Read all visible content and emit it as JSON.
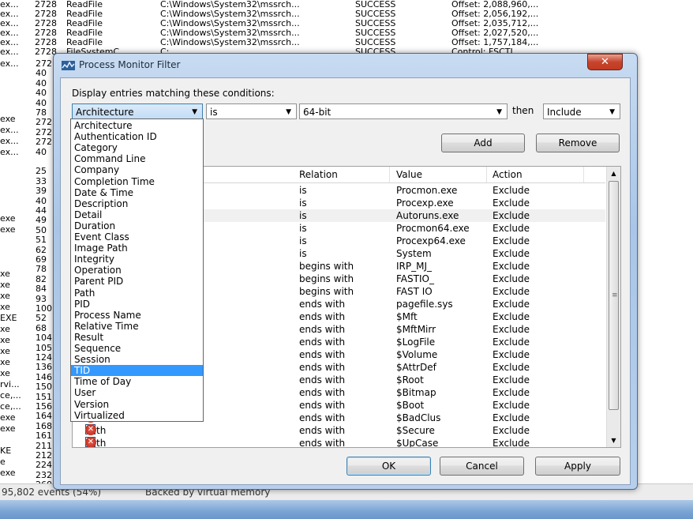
{
  "background": {
    "rows": [
      {
        "name": "ex...",
        "pid": "2728",
        "op": "ReadFile",
        "path": "C:\\Windows\\System32\\mssrch...",
        "result": "SUCCESS",
        "detail": "Offset: 2,088,960,..."
      },
      {
        "name": "ex...",
        "pid": "2728",
        "op": "ReadFile",
        "path": "C:\\Windows\\System32\\mssrch...",
        "result": "SUCCESS",
        "detail": "Offset: 2,056,192,..."
      },
      {
        "name": "ex...",
        "pid": "2728",
        "op": "ReadFile",
        "path": "C:\\Windows\\System32\\mssrch...",
        "result": "SUCCESS",
        "detail": "Offset: 2,035,712,..."
      },
      {
        "name": "ex...",
        "pid": "2728",
        "op": "ReadFile",
        "path": "C:\\Windows\\System32\\mssrch...",
        "result": "SUCCESS",
        "detail": "Offset: 2,027,520,..."
      },
      {
        "name": "ex...",
        "pid": "2728",
        "op": "ReadFile",
        "path": "C:\\Windows\\System32\\mssrch...",
        "result": "SUCCESS",
        "detail": "Offset: 1,757,184,..."
      },
      {
        "name": "ex...",
        "pid": "2728",
        "op": "FileSystemC...",
        "path": "C:",
        "result": "SUCCESS",
        "detail": "Control: FSCTL..."
      }
    ],
    "side_names": [
      "ex...",
      "",
      "",
      "",
      "",
      "exe",
      "ex...",
      "ex...",
      "ex...",
      "",
      "",
      "",
      "",
      "",
      "exe",
      "exe",
      "",
      "",
      "",
      "xe",
      "xe",
      "xe",
      "xe",
      "EXE",
      "xe",
      "xe",
      "xe",
      "xe",
      "xe",
      "rvi...",
      "ce,...",
      "ce,...",
      "exe",
      "exe",
      "",
      "KE",
      "e",
      "exe",
      "",
      "",
      "exe"
    ],
    "side_pids": [
      "272",
      "40",
      "40",
      "40",
      "40",
      "78",
      "272",
      "272",
      "272",
      "40",
      "",
      "25",
      "33",
      "39",
      "40",
      "44",
      "49",
      "50",
      "51",
      "62",
      "69",
      "78",
      "82",
      "84",
      "93",
      "100",
      "52",
      "68",
      "104",
      "105",
      "124",
      "136",
      "146",
      "150",
      "151",
      "156",
      "164",
      "168",
      "161",
      "211",
      "212",
      "224",
      "232",
      "260"
    ],
    "status_events": "95,802 events (54%)",
    "status_memory": "Backed by virtual memory"
  },
  "dialog": {
    "title": "Process Monitor Filter",
    "close_label": "✕",
    "conditions_label": "Display entries matching these conditions:",
    "column_select": "Architecture",
    "relation_select": "is",
    "value_input": "64-bit",
    "then_label": "then",
    "action_select": "Include",
    "add_label": "Add",
    "remove_label": "Remove",
    "ok_label": "OK",
    "cancel_label": "Cancel",
    "apply_label": "Apply"
  },
  "table": {
    "headers": {
      "relation": "Relation",
      "value": "Value",
      "action": "Action"
    },
    "rows": [
      {
        "column": "",
        "relation": "is",
        "value": "Procmon.exe",
        "action": "Exclude"
      },
      {
        "column": "",
        "relation": "is",
        "value": "Procexp.exe",
        "action": "Exclude"
      },
      {
        "column": "",
        "relation": "is",
        "value": "Autoruns.exe",
        "action": "Exclude"
      },
      {
        "column": "",
        "relation": "is",
        "value": "Procmon64.exe",
        "action": "Exclude"
      },
      {
        "column": "",
        "relation": "is",
        "value": "Procexp64.exe",
        "action": "Exclude"
      },
      {
        "column": "",
        "relation": "is",
        "value": "System",
        "action": "Exclude"
      },
      {
        "column": "",
        "relation": "begins with",
        "value": "IRP_MJ_",
        "action": "Exclude"
      },
      {
        "column": "",
        "relation": "begins with",
        "value": "FASTIO_",
        "action": "Exclude"
      },
      {
        "column": "",
        "relation": "begins with",
        "value": "FAST IO",
        "action": "Exclude"
      },
      {
        "column": "",
        "relation": "ends with",
        "value": "pagefile.sys",
        "action": "Exclude"
      },
      {
        "column": "",
        "relation": "ends with",
        "value": "$Mft",
        "action": "Exclude"
      },
      {
        "column": "",
        "relation": "ends with",
        "value": "$MftMirr",
        "action": "Exclude"
      },
      {
        "column": "",
        "relation": "ends with",
        "value": "$LogFile",
        "action": "Exclude"
      },
      {
        "column": "",
        "relation": "ends with",
        "value": "$Volume",
        "action": "Exclude"
      },
      {
        "column": "",
        "relation": "ends with",
        "value": "$AttrDef",
        "action": "Exclude"
      },
      {
        "column": "",
        "relation": "ends with",
        "value": "$Root",
        "action": "Exclude"
      },
      {
        "column": "",
        "relation": "ends with",
        "value": "$Bitmap",
        "action": "Exclude"
      },
      {
        "column": "",
        "relation": "ends with",
        "value": "$Boot",
        "action": "Exclude"
      },
      {
        "column": "",
        "relation": "ends with",
        "value": "$BadClus",
        "action": "Exclude"
      },
      {
        "column": "Path",
        "relation": "ends with",
        "value": "$Secure",
        "action": "Exclude"
      },
      {
        "column": "Path",
        "relation": "ends with",
        "value": "$UpCase",
        "action": "Exclude"
      }
    ]
  },
  "dropdown": {
    "selected": "TID",
    "items": [
      "Architecture",
      "Authentication ID",
      "Category",
      "Command Line",
      "Company",
      "Completion Time",
      "Date & Time",
      "Description",
      "Detail",
      "Duration",
      "Event Class",
      "Image Path",
      "Integrity",
      "Operation",
      "Parent PID",
      "Path",
      "PID",
      "Process Name",
      "Relative Time",
      "Result",
      "Sequence",
      "Session",
      "TID",
      "Time of Day",
      "User",
      "Version",
      "Virtualized"
    ]
  },
  "colors": {
    "selection": "#3399ff",
    "title_bar": "#b7cfeb",
    "close_button": "#c6452e"
  }
}
